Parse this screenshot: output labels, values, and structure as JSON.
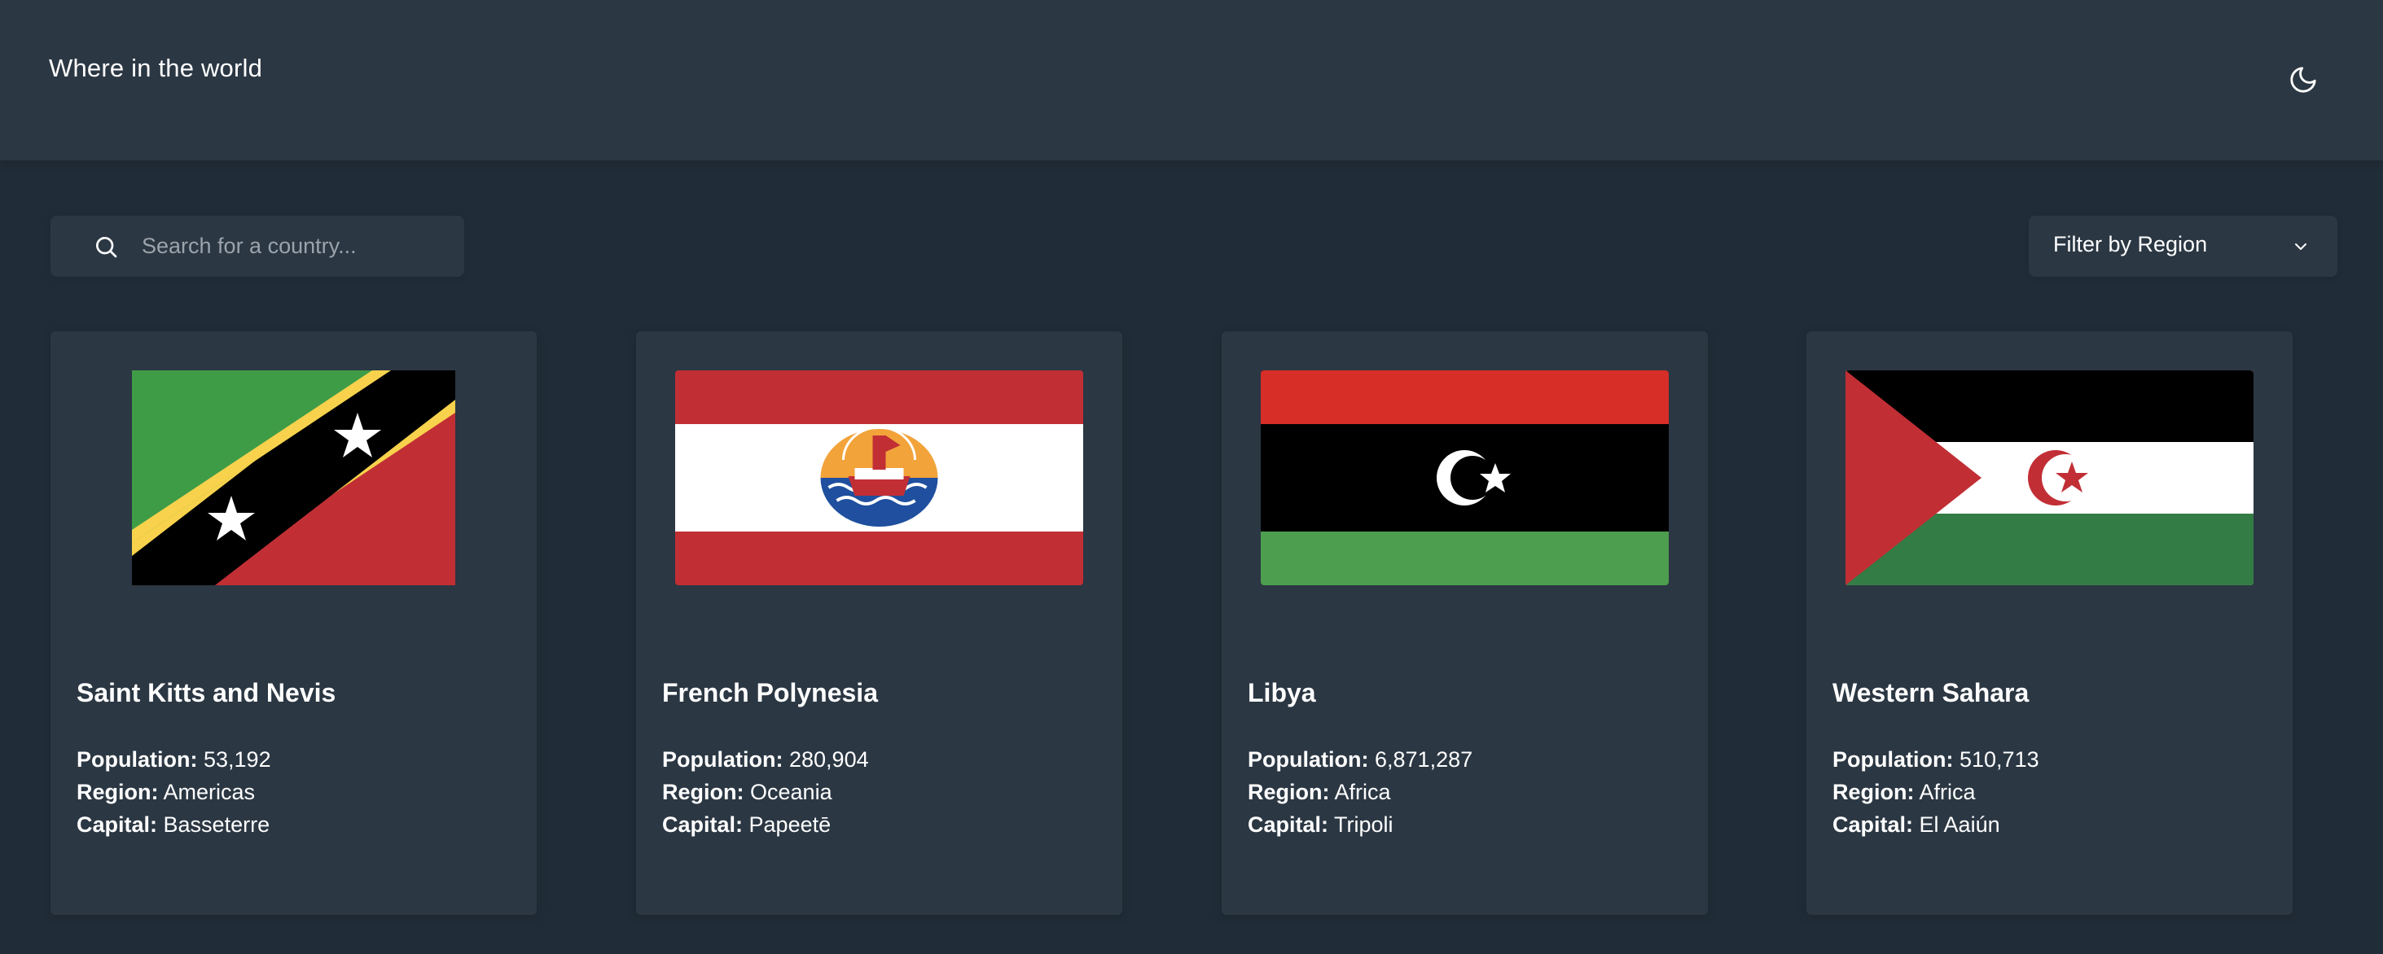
{
  "header": {
    "title": "Where in the world",
    "theme_icon": "moon-icon"
  },
  "search": {
    "placeholder": "Search for a country...",
    "value": "",
    "icon": "search-icon"
  },
  "filter": {
    "label": "Filter by Region",
    "icon": "chevron-down-icon"
  },
  "labels": {
    "population": "Population:",
    "region": "Region:",
    "capital": "Capital:"
  },
  "countries": [
    {
      "name": "Saint Kitts and Nevis",
      "population": "53,192",
      "region": "Americas",
      "capital": "Basseterre",
      "flag_icon": "saint-kitts-and-nevis-flag"
    },
    {
      "name": "French Polynesia",
      "population": "280,904",
      "region": "Oceania",
      "capital": "Papeetē",
      "flag_icon": "french-polynesia-flag"
    },
    {
      "name": "Libya",
      "population": "6,871,287",
      "region": "Africa",
      "capital": "Tripoli",
      "flag_icon": "libya-flag"
    },
    {
      "name": "Western Sahara",
      "population": "510,713",
      "region": "Africa",
      "capital": "El Aaiún",
      "flag_icon": "western-sahara-flag"
    }
  ],
  "colors": {
    "background": "#202c37",
    "element": "#2b3743",
    "text": "#ffffff",
    "placeholder": "#9ba3ab"
  }
}
